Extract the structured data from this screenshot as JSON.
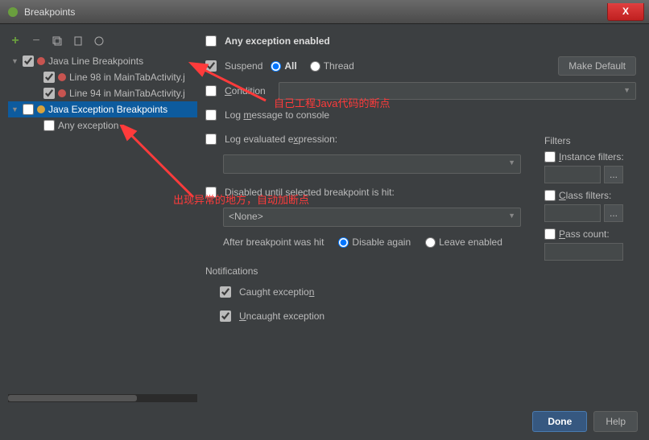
{
  "titlebar": {
    "title": "Breakpoints",
    "close": "X"
  },
  "toolbar": {
    "plus": "+",
    "minus": "−"
  },
  "tree": {
    "group1": {
      "label": "Java Line Breakpoints"
    },
    "item1": {
      "label": "Line 98 in MainTabActivity.j"
    },
    "item2": {
      "label": "Line 94 in MainTabActivity.j"
    },
    "group2": {
      "label": "Java Exception Breakpoints"
    },
    "item3": {
      "label": "Any exception"
    }
  },
  "main": {
    "any_exception": "Any exception enabled",
    "suspend": "Suspend",
    "all": "All",
    "thread": "Thread",
    "make_default": "Make Default",
    "condition": "Condition",
    "log_message": "Log message to console",
    "log_expr": "Log evaluated expression:",
    "disabled_until": "Disabled until selected breakpoint is hit:",
    "none": "<None>",
    "after_hit": "After breakpoint was hit",
    "disable_again": "Disable again",
    "leave_enabled": "Leave enabled",
    "notifications": "Notifications",
    "caught": "Caught exception",
    "uncaught": "Uncaught exception"
  },
  "filters": {
    "title": "Filters",
    "instance": "Instance filters:",
    "class": "Class filters:",
    "pass": "Pass count:",
    "browse": "..."
  },
  "footer": {
    "done": "Done",
    "help": "Help"
  },
  "annotations": {
    "a1": "自己工程Java代码的断点",
    "a2": "出现异常的地方，自动加断点"
  }
}
